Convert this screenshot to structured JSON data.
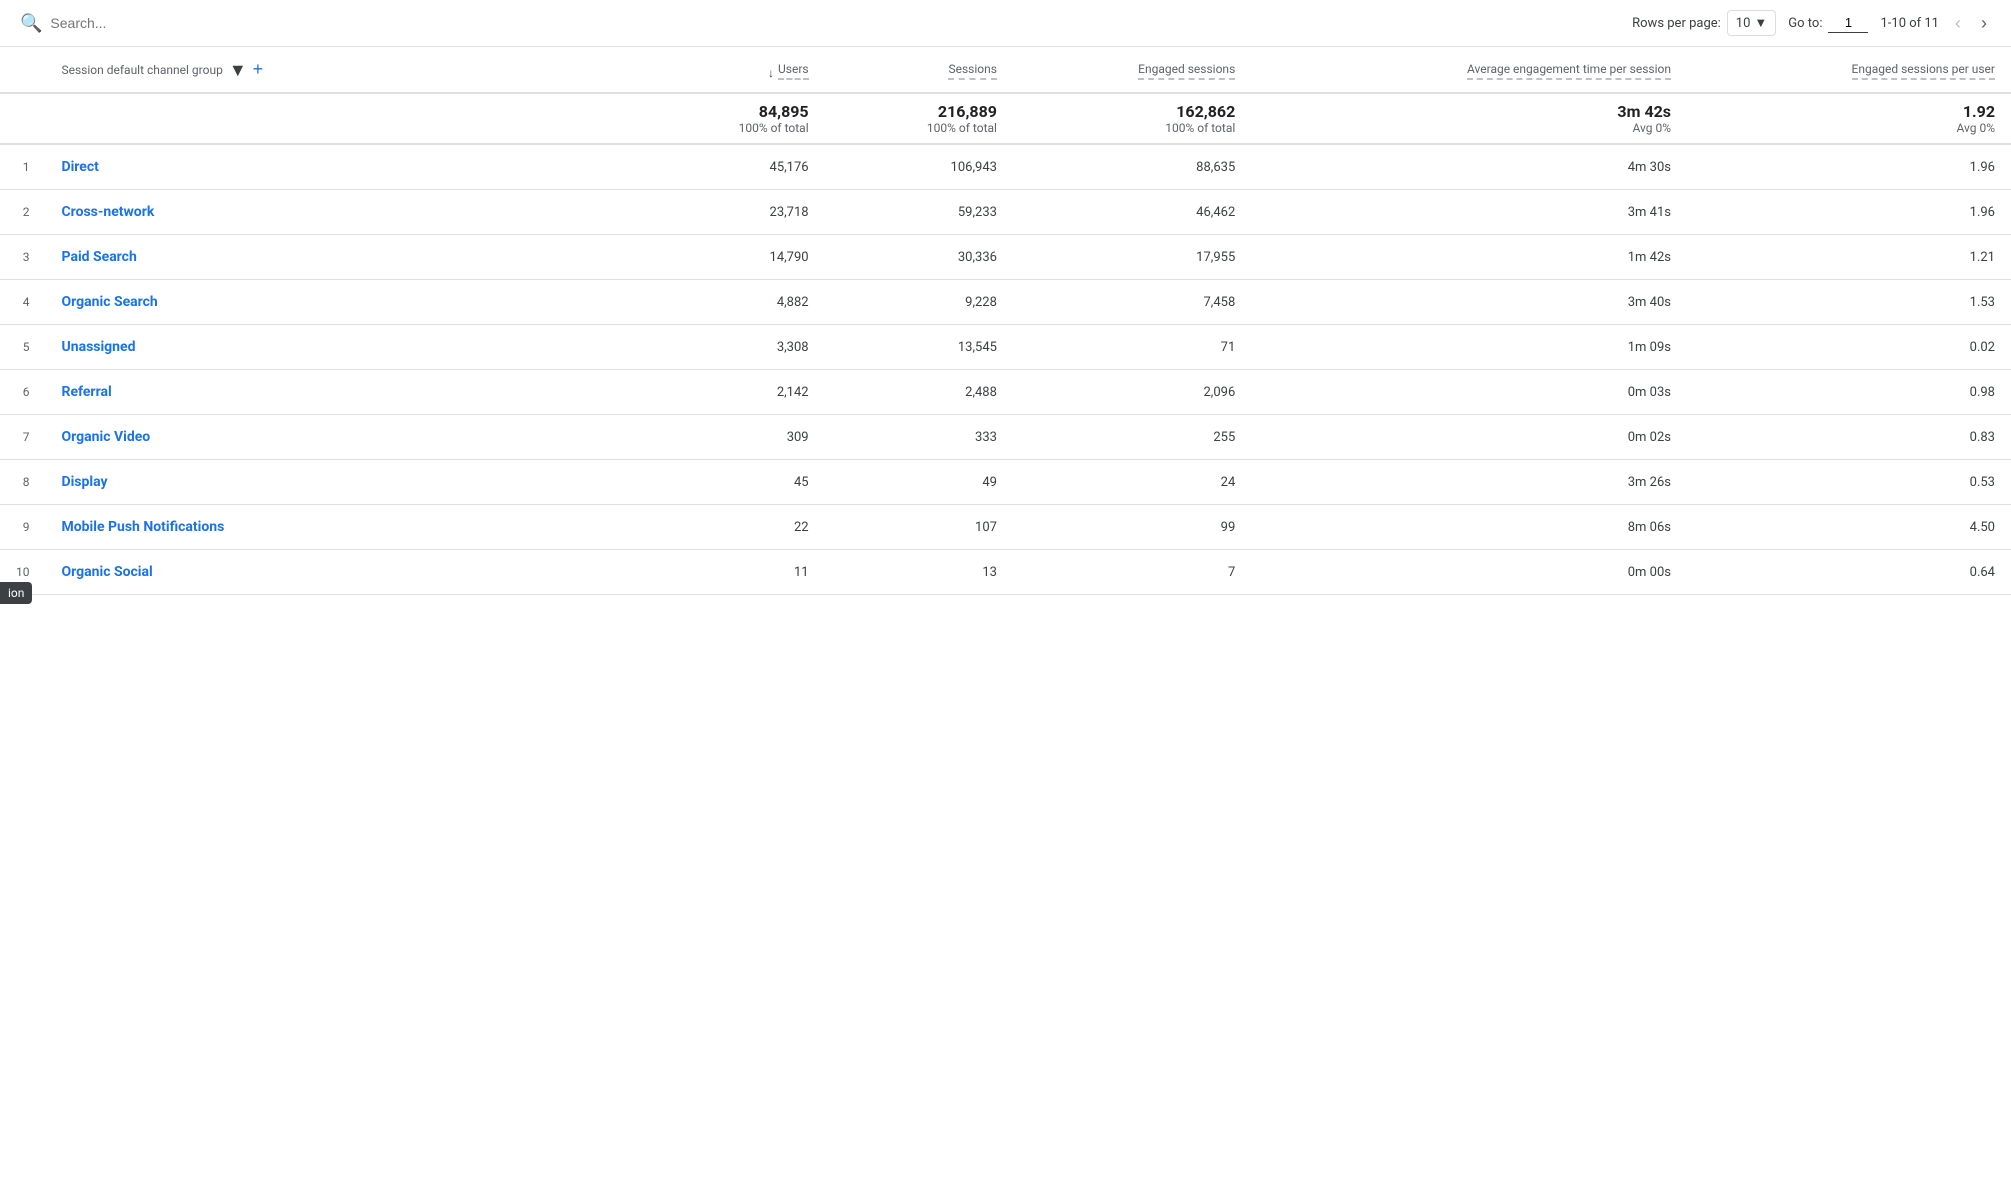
{
  "toolbar": {
    "search_placeholder": "Search...",
    "rows_per_page_label": "Rows per page:",
    "rows_per_page_value": "10",
    "go_to_label": "Go to:",
    "go_to_value": "1",
    "page_info": "1-10 of 11"
  },
  "table": {
    "dimension_col_label": "Session default channel group",
    "columns": [
      {
        "key": "users",
        "label": "Users",
        "sorted": true
      },
      {
        "key": "sessions",
        "label": "Sessions",
        "sorted": false
      },
      {
        "key": "engaged_sessions",
        "label": "Engaged sessions",
        "sorted": false
      },
      {
        "key": "avg_engagement",
        "label": "Average engagement time per session",
        "sorted": false
      },
      {
        "key": "engaged_per_user",
        "label": "Engaged sessions per user",
        "sorted": false
      }
    ],
    "summary": {
      "users_value": "84,895",
      "users_pct": "100% of total",
      "sessions_value": "216,889",
      "sessions_pct": "100% of total",
      "engaged_value": "162,862",
      "engaged_pct": "100% of total",
      "avg_eng_value": "3m 42s",
      "avg_eng_pct": "Avg 0%",
      "engaged_per_user_value": "1.92",
      "engaged_per_user_pct": "Avg 0%"
    },
    "rows": [
      {
        "rank": 1,
        "channel": "Direct",
        "users": "45,176",
        "sessions": "106,943",
        "engaged": "88,635",
        "avg_eng": "4m 30s",
        "eng_per_user": "1.96"
      },
      {
        "rank": 2,
        "channel": "Cross-network",
        "users": "23,718",
        "sessions": "59,233",
        "engaged": "46,462",
        "avg_eng": "3m 41s",
        "eng_per_user": "1.96"
      },
      {
        "rank": 3,
        "channel": "Paid Search",
        "users": "14,790",
        "sessions": "30,336",
        "engaged": "17,955",
        "avg_eng": "1m 42s",
        "eng_per_user": "1.21"
      },
      {
        "rank": 4,
        "channel": "Organic Search",
        "users": "4,882",
        "sessions": "9,228",
        "engaged": "7,458",
        "avg_eng": "3m 40s",
        "eng_per_user": "1.53"
      },
      {
        "rank": 5,
        "channel": "Unassigned",
        "users": "3,308",
        "sessions": "13,545",
        "engaged": "71",
        "avg_eng": "1m 09s",
        "eng_per_user": "0.02"
      },
      {
        "rank": 6,
        "channel": "Referral",
        "users": "2,142",
        "sessions": "2,488",
        "engaged": "2,096",
        "avg_eng": "0m 03s",
        "eng_per_user": "0.98"
      },
      {
        "rank": 7,
        "channel": "Organic Video",
        "users": "309",
        "sessions": "333",
        "engaged": "255",
        "avg_eng": "0m 02s",
        "eng_per_user": "0.83"
      },
      {
        "rank": 8,
        "channel": "Display",
        "users": "45",
        "sessions": "49",
        "engaged": "24",
        "avg_eng": "3m 26s",
        "eng_per_user": "0.53"
      },
      {
        "rank": 9,
        "channel": "Mobile Push Notifications",
        "users": "22",
        "sessions": "107",
        "engaged": "99",
        "avg_eng": "8m 06s",
        "eng_per_user": "4.50"
      },
      {
        "rank": 10,
        "channel": "Organic Social",
        "users": "11",
        "sessions": "13",
        "engaged": "7",
        "avg_eng": "0m 00s",
        "eng_per_user": "0.64"
      }
    ]
  },
  "side_label": "ion"
}
